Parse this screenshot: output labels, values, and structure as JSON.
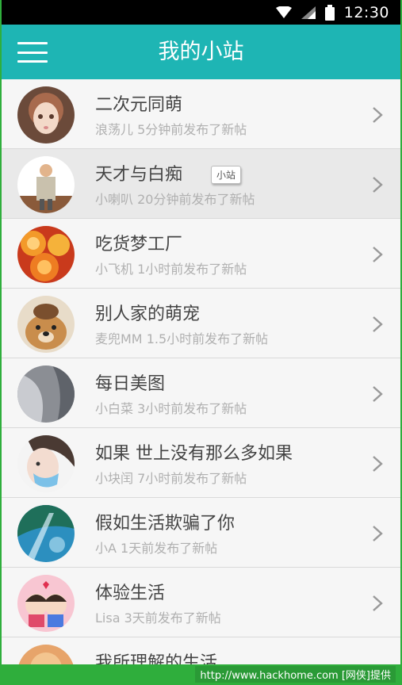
{
  "status_bar": {
    "time": "12:30"
  },
  "app_bar": {
    "title": "我的小站"
  },
  "list": [
    {
      "title": "二次元同萌",
      "subtitle": "浪荡儿 5分钟前发布了新帖"
    },
    {
      "title": "天才与白痴",
      "subtitle": "小喇叭 20分钟前发布了新帖",
      "tag": "小站"
    },
    {
      "title": "吃货梦工厂",
      "subtitle": "小飞机 1小时前发布了新帖"
    },
    {
      "title": "别人家的萌宠",
      "subtitle": "麦兜MM 1.5小时前发布了新帖"
    },
    {
      "title": "每日美图",
      "subtitle": "小白菜 3小时前发布了新帖"
    },
    {
      "title": "如果 世上没有那么多如果",
      "subtitle": "小块闰 7小时前发布了新帖"
    },
    {
      "title": "假如生活欺骗了你",
      "subtitle": "小A 1天前发布了新帖"
    },
    {
      "title": "体验生活",
      "subtitle": "Lisa 3天前发布了新帖"
    },
    {
      "title": "我所理解的生活",
      "subtitle": ""
    }
  ],
  "watermark": "http://www.hackhome.com [网侠]提供",
  "colors": {
    "accent": "#1eb5b4",
    "frame": "#2fae3c"
  }
}
